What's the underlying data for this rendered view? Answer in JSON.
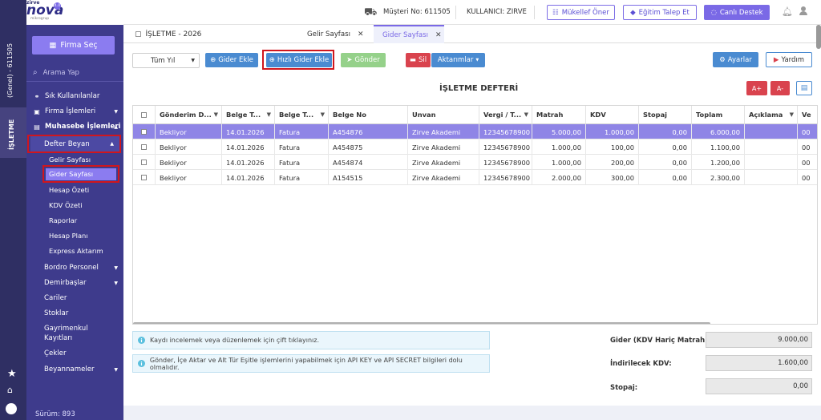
{
  "logo": {
    "small": "zirve",
    "main": "nova",
    "badge": "4.0",
    "sub": "mikrogrup"
  },
  "header": {
    "customer_no": "Müşteri No: 611505",
    "user": "KULLANICI: ZIRVE",
    "btn_onerr": "Mükellef Öner",
    "btn_egitim": "Eğitim Talep Et",
    "btn_destek": "Canlı Destek"
  },
  "rail": {
    "top_label": "(Genel) - 611505",
    "tab_label": "İŞLETME"
  },
  "sidebar": {
    "firma_sec": "Firma Seç",
    "search_placeholder": "Arama Yap",
    "items": [
      {
        "label": "Sık Kullanılanlar"
      },
      {
        "label": "Firma İşlemleri"
      },
      {
        "label": "Muhasebe İşlemleri"
      },
      {
        "label": "Defter Beyan"
      }
    ],
    "subitems": [
      "Gelir Sayfası",
      "Gider Sayfası",
      "Hesap Özeti",
      "KDV Özeti",
      "Raporlar",
      "Hesap Planı",
      "Express Aktarım"
    ],
    "more": [
      "Bordro Personel",
      "Demirbaşlar",
      "Cariler",
      "Stoklar",
      "Gayrimenkul Kayıtları",
      "Çekler",
      "Beyannameler"
    ],
    "version": "Sürüm: 893"
  },
  "tabs": {
    "title": "İŞLETME - 2026",
    "tab1": "Gelir Sayfası",
    "tab2": "Gider Sayfası"
  },
  "toolbar": {
    "year": "Tüm Yıl",
    "gider_ekle": "Gider Ekle",
    "hizli_gider": "Hızlı Gider Ekle",
    "gonder": "Gönder",
    "sil": "Sil",
    "aktarimlar": "Aktarımlar",
    "ayarlar": "Ayarlar",
    "yardim": "Yardım"
  },
  "section_title": "İŞLETME DEFTERİ",
  "font_up": "A+",
  "font_down": "A-",
  "table": {
    "columns": [
      "Gönderim D...",
      "Belge T...",
      "Belge T...",
      "Belge No",
      "Unvan",
      "Vergi / T...",
      "Matrah",
      "KDV",
      "Stopaj",
      "Toplam",
      "Açıklama",
      "Ve"
    ],
    "rows": [
      [
        "Bekliyor",
        "14.01.2026",
        "Fatura",
        "A454876",
        "Zirve Akademi",
        "12345678900",
        "5.000,00",
        "1.000,00",
        "0,00",
        "6.000,00",
        "",
        "00"
      ],
      [
        "Bekliyor",
        "14.01.2026",
        "Fatura",
        "A454875",
        "Zirve Akademi",
        "12345678900",
        "1.000,00",
        "100,00",
        "0,00",
        "1.100,00",
        "",
        "00"
      ],
      [
        "Bekliyor",
        "14.01.2026",
        "Fatura",
        "A454874",
        "Zirve Akademi",
        "12345678900",
        "1.000,00",
        "200,00",
        "0,00",
        "1.200,00",
        "",
        "00"
      ],
      [
        "Bekliyor",
        "14.01.2026",
        "Fatura",
        "A154515",
        "Zirve Akademi",
        "12345678900",
        "2.000,00",
        "300,00",
        "0,00",
        "2.300,00",
        "",
        "00"
      ]
    ]
  },
  "info": {
    "line1": "Kaydı incelemek veya düzenlemek için çift tıklayınız.",
    "line2": "Gönder, İçe Aktar ve Alt Tür Eşitle işlemlerini yapabilmek için API KEY ve API SECRET bilgileri dolu olmalıdır."
  },
  "summary": {
    "gider_label": "Gider (KDV Hariç Matrah):",
    "gider_value": "9.000,00",
    "kdv_label": "İndirilecek KDV:",
    "kdv_value": "1.600,00",
    "stopaj_label": "Stopaj:",
    "stopaj_value": "0,00"
  },
  "colors": {
    "sidebar": "#3e3b8c",
    "rail": "#2f2f63",
    "accent": "#7a69e6",
    "highlight": "#d0161d",
    "selected_row": "#8f85e6"
  }
}
